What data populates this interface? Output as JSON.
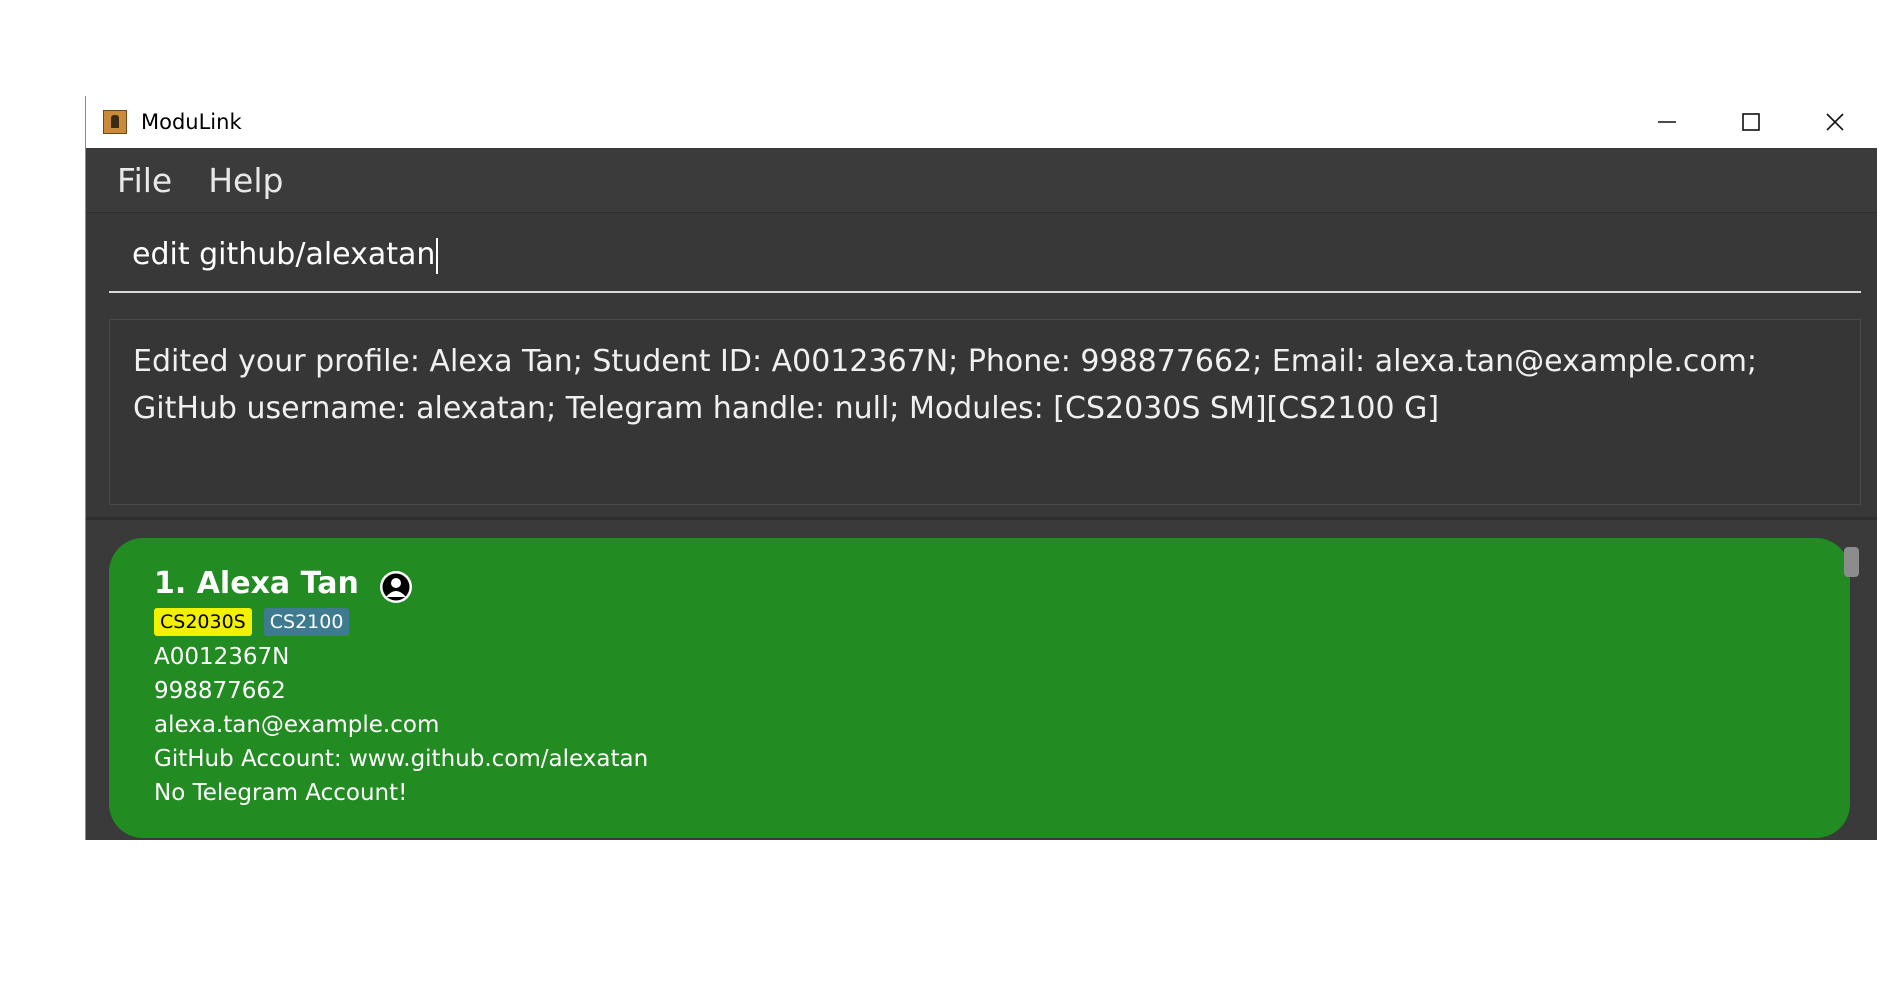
{
  "window": {
    "title": "ModuLink"
  },
  "menu": {
    "file": "File",
    "help": "Help"
  },
  "command": {
    "value": "edit github/alexatan"
  },
  "result": {
    "message": "Edited your profile: Alexa Tan; Student ID: A0012367N; Phone: 998877662; Email: alexa.tan@example.com; GitHub username: alexatan; Telegram handle: null; Modules: [CS2030S SM][CS2100 G]"
  },
  "person_card": {
    "name": "1. Alexa Tan",
    "tags": [
      "CS2030S",
      "CS2100"
    ],
    "student_id": "A0012367N",
    "phone": "998877662",
    "email": "alexa.tan@example.com",
    "github": "GitHub Account: www.github.com/alexatan",
    "telegram": "No Telegram Account!",
    "tag_colors": {
      "yellow": "#f2f200",
      "blue": "#3e7b91"
    },
    "card_color": "#228b22"
  }
}
